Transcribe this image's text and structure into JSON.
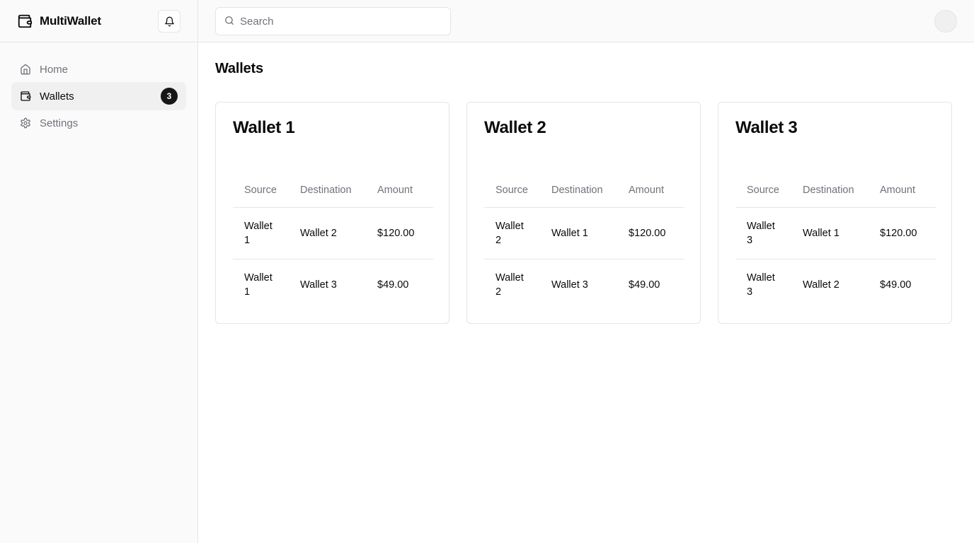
{
  "app": {
    "name": "MultiWallet"
  },
  "sidebar": {
    "items": [
      {
        "label": "Home",
        "icon": "home-icon"
      },
      {
        "label": "Wallets",
        "icon": "wallet-icon",
        "badge": "3",
        "active": true
      },
      {
        "label": "Settings",
        "icon": "gear-icon"
      }
    ]
  },
  "search": {
    "placeholder": "Search",
    "value": ""
  },
  "page": {
    "title": "Wallets"
  },
  "table_headers": {
    "source": "Source",
    "destination": "Destination",
    "amount": "Amount"
  },
  "wallets": [
    {
      "title": "Wallet 1",
      "rows": [
        {
          "source": "Wallet 1",
          "destination": "Wallet 2",
          "amount": "$120.00"
        },
        {
          "source": "Wallet 1",
          "destination": "Wallet 3",
          "amount": "$49.00"
        }
      ]
    },
    {
      "title": "Wallet 2",
      "rows": [
        {
          "source": "Wallet 2",
          "destination": "Wallet 1",
          "amount": "$120.00"
        },
        {
          "source": "Wallet 2",
          "destination": "Wallet 3",
          "amount": "$49.00"
        }
      ]
    },
    {
      "title": "Wallet 3",
      "rows": [
        {
          "source": "Wallet 3",
          "destination": "Wallet 1",
          "amount": "$120.00"
        },
        {
          "source": "Wallet 3",
          "destination": "Wallet 2",
          "amount": "$49.00"
        }
      ]
    }
  ],
  "colors": {
    "accent": "#171717",
    "muted_text": "#71717a",
    "border": "#e5e5e5",
    "sidebar_bg": "#fafafa"
  }
}
